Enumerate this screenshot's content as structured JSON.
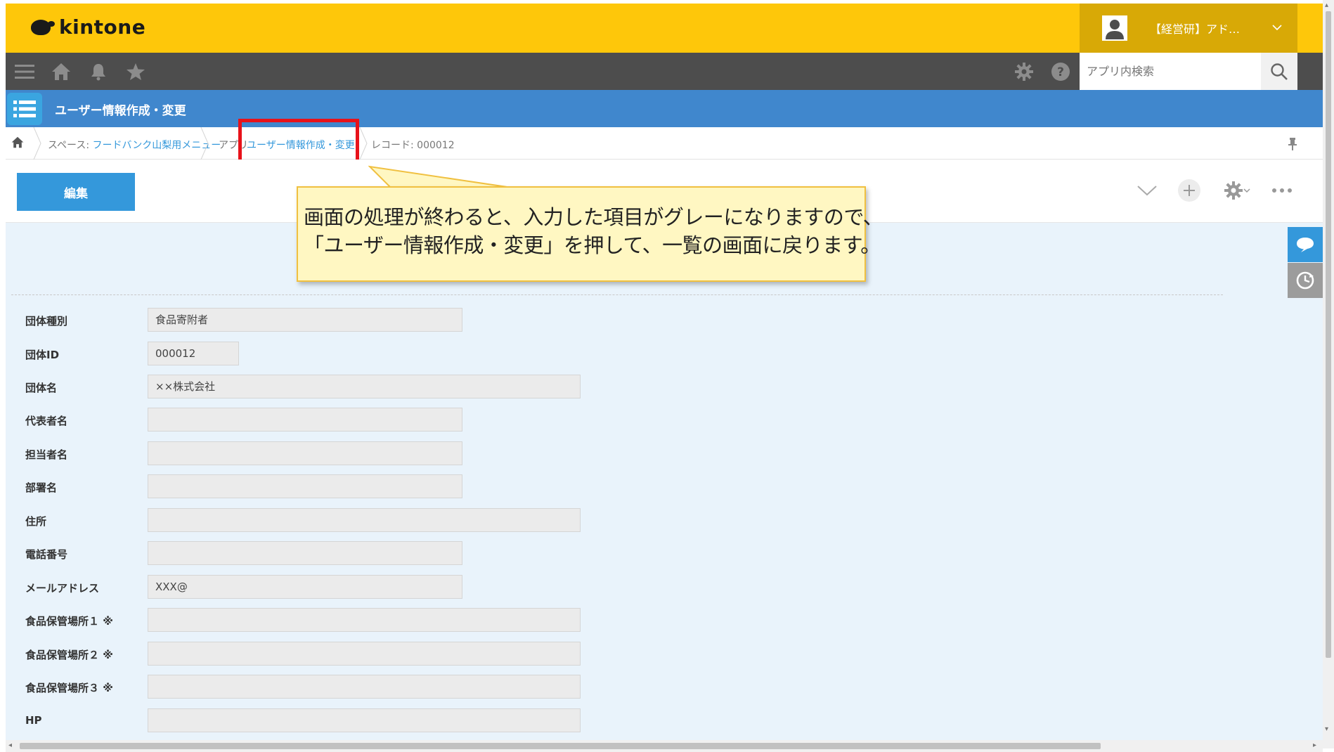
{
  "header": {
    "logo_text": "kintone",
    "user_name": "【経営研】アド…"
  },
  "nav": {
    "search_placeholder": "アプリ内検索"
  },
  "app": {
    "title": "ユーザー情報作成・変更"
  },
  "breadcrumb": {
    "space_prefix": "スペース: ",
    "space_name": "フードバンク山梨用メニュー",
    "app_prefix": "アプリ",
    "app_name": "ユーザー情報作成・変更",
    "record": "レコード: 000012"
  },
  "toolbar": {
    "edit_label": "編集"
  },
  "callout": {
    "line1": "画面の処理が終わると、入力した項目がグレーになりますので、",
    "line2": "「ユーザー情報作成・変更」を押して、一覧の画面に戻ります。"
  },
  "fields": [
    {
      "label": "団体種別",
      "value": "食品寄附者"
    },
    {
      "label": "団体ID",
      "value": "000012"
    },
    {
      "label": "団体名",
      "value": "××株式会社"
    },
    {
      "label": "代表者名",
      "value": ""
    },
    {
      "label": "担当者名",
      "value": ""
    },
    {
      "label": "部署名",
      "value": ""
    },
    {
      "label": "住所",
      "value": ""
    },
    {
      "label": "電話番号",
      "value": ""
    },
    {
      "label": "メールアドレス",
      "value": "XXX@"
    },
    {
      "label": "食品保管場所１ ※",
      "value": ""
    },
    {
      "label": "食品保管場所２ ※",
      "value": ""
    },
    {
      "label": "食品保管場所３ ※",
      "value": ""
    },
    {
      "label": "HP",
      "value": ""
    }
  ],
  "colors": {
    "header_yellow": "#fec70a",
    "nav_dark": "#4d4d4d",
    "app_bar_blue": "#4087cd",
    "button_blue": "#3498db",
    "highlight_red": "#e8121a",
    "callout_bg": "#fff7c2"
  }
}
